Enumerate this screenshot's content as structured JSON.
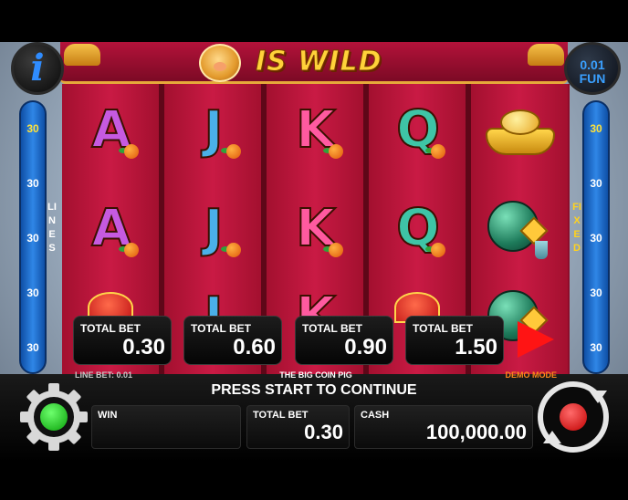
{
  "header": {
    "title": "IS WILD",
    "info_icon": "i",
    "denom_line1": "0.01",
    "denom_line2": "FUN"
  },
  "left_rail": {
    "label": "LINES",
    "numbers": [
      "30",
      "30",
      "30",
      "30",
      "30"
    ]
  },
  "right_rail": {
    "label": "FIXED",
    "numbers": [
      "30",
      "30",
      "30",
      "30",
      "30"
    ]
  },
  "reels": [
    {
      "symbols": [
        "A",
        "A",
        "red-bag"
      ]
    },
    {
      "symbols": [
        "J",
        "J",
        "J"
      ]
    },
    {
      "symbols": [
        "K",
        "K",
        "K"
      ]
    },
    {
      "symbols": [
        "Q",
        "Q",
        "red-bag"
      ]
    },
    {
      "symbols": [
        "gold-ingot",
        "jade-lantern",
        "jade-lantern"
      ]
    }
  ],
  "bet_options": [
    {
      "label": "TOTAL BET",
      "value": "0.30"
    },
    {
      "label": "TOTAL BET",
      "value": "0.60"
    },
    {
      "label": "TOTAL BET",
      "value": "0.90"
    },
    {
      "label": "TOTAL BET",
      "value": "1.50"
    }
  ],
  "info_bar": {
    "line_bet": "LINE BET: 0.01",
    "game_name": "THE BIG COIN PIG",
    "mode": "DEMO MODE"
  },
  "bottom": {
    "prompt": "PRESS START TO CONTINUE",
    "win_label": "WIN",
    "win_value": "",
    "total_bet_label": "TOTAL BET",
    "total_bet_value": "0.30",
    "cash_label": "CASH",
    "cash_value": "100,000.00"
  },
  "colors": {
    "accent_red": "#ff1414",
    "rail_blue": "#2f86e6",
    "settings_green": "#08a008",
    "demo_orange": "#ff8a1a"
  }
}
